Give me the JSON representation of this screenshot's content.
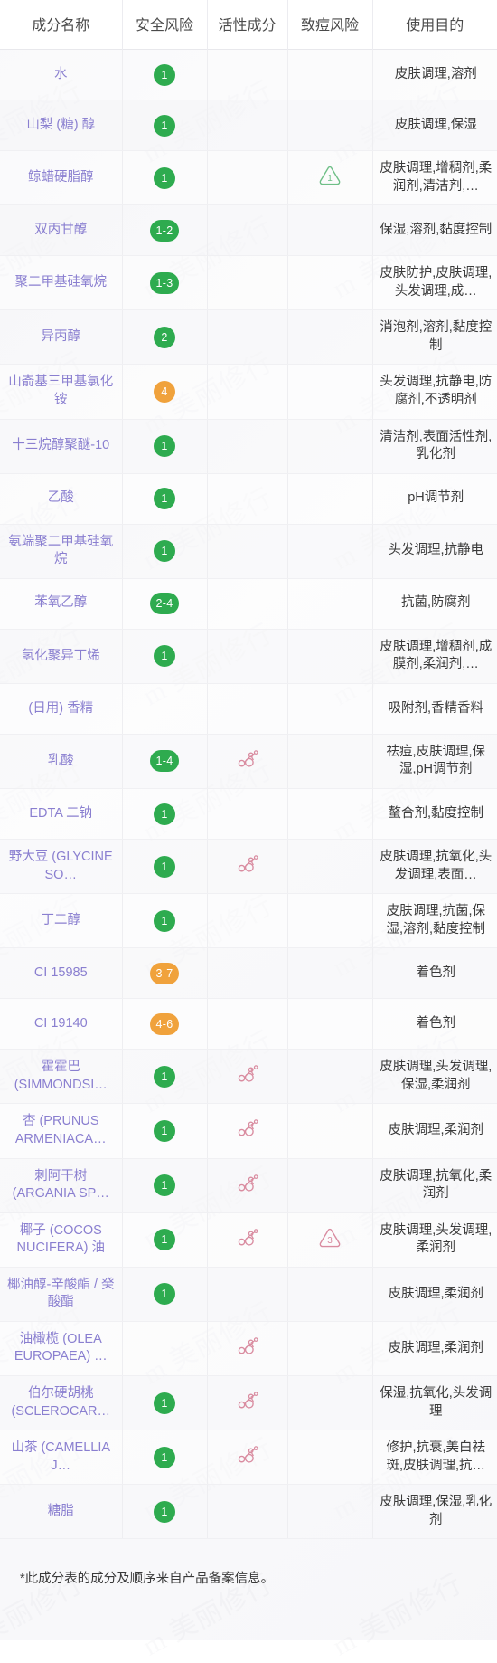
{
  "table": {
    "columns": [
      "成分名称",
      "安全风险",
      "活性成分",
      "致痘风险",
      "使用目的"
    ],
    "icons": {
      "active_ingredient": "molecule-icon",
      "acne_risk": "warning-triangle-icon"
    },
    "colors": {
      "badge_green": "#2eab4f",
      "badge_orange": "#f0a23c",
      "name_text": "#8a7fd0",
      "triangle_green": "#6fbf87",
      "triangle_pink": "#d98ca0",
      "molecule_pink": "#d98ca0"
    },
    "rows": [
      {
        "name": "水",
        "risk": "1",
        "risk_level": "green",
        "active": false,
        "acne": "",
        "acne_level": "",
        "use": "皮肤调理,溶剂"
      },
      {
        "name": "山梨 (糖) 醇",
        "risk": "1",
        "risk_level": "green",
        "active": false,
        "acne": "",
        "acne_level": "",
        "use": "皮肤调理,保湿"
      },
      {
        "name": "鲸蜡硬脂醇",
        "risk": "1",
        "risk_level": "green",
        "active": false,
        "acne": "1",
        "acne_level": "green",
        "use": "皮肤调理,增稠剂,柔润剂,清洁剂,…"
      },
      {
        "name": "双丙甘醇",
        "risk": "1-2",
        "risk_level": "green",
        "active": false,
        "acne": "",
        "acne_level": "",
        "use": "保湿,溶剂,黏度控制"
      },
      {
        "name": "聚二甲基硅氧烷",
        "risk": "1-3",
        "risk_level": "green",
        "active": false,
        "acne": "",
        "acne_level": "",
        "use": "皮肤防护,皮肤调理,头发调理,成…"
      },
      {
        "name": "异丙醇",
        "risk": "2",
        "risk_level": "green",
        "active": false,
        "acne": "",
        "acne_level": "",
        "use": "消泡剂,溶剂,黏度控制"
      },
      {
        "name": "山嵛基三甲基氯化铵",
        "risk": "4",
        "risk_level": "orange",
        "active": false,
        "acne": "",
        "acne_level": "",
        "use": "头发调理,抗静电,防腐剂,不透明剂"
      },
      {
        "name": "十三烷醇聚醚-10",
        "risk": "1",
        "risk_level": "green",
        "active": false,
        "acne": "",
        "acne_level": "",
        "use": "清洁剂,表面活性剂,乳化剂"
      },
      {
        "name": "乙酸",
        "risk": "1",
        "risk_level": "green",
        "active": false,
        "acne": "",
        "acne_level": "",
        "use": "pH调节剂"
      },
      {
        "name": "氨端聚二甲基硅氧烷",
        "risk": "1",
        "risk_level": "green",
        "active": false,
        "acne": "",
        "acne_level": "",
        "use": "头发调理,抗静电"
      },
      {
        "name": "苯氧乙醇",
        "risk": "2-4",
        "risk_level": "green",
        "active": false,
        "acne": "",
        "acne_level": "",
        "use": "抗菌,防腐剂"
      },
      {
        "name": "氢化聚异丁烯",
        "risk": "1",
        "risk_level": "green",
        "active": false,
        "acne": "",
        "acne_level": "",
        "use": "皮肤调理,增稠剂,成膜剂,柔润剂,…"
      },
      {
        "name": "(日用) 香精",
        "risk": "",
        "risk_level": "",
        "active": false,
        "acne": "",
        "acne_level": "",
        "use": "吸附剂,香精香料"
      },
      {
        "name": "乳酸",
        "risk": "1-4",
        "risk_level": "green",
        "active": true,
        "acne": "",
        "acne_level": "",
        "use": "祛痘,皮肤调理,保湿,pH调节剂"
      },
      {
        "name": "EDTA 二钠",
        "risk": "1",
        "risk_level": "green",
        "active": false,
        "acne": "",
        "acne_level": "",
        "use": "螯合剂,黏度控制"
      },
      {
        "name": "野大豆 (GLYCINE SO…",
        "risk": "1",
        "risk_level": "green",
        "active": true,
        "acne": "",
        "acne_level": "",
        "use": "皮肤调理,抗氧化,头发调理,表面…"
      },
      {
        "name": "丁二醇",
        "risk": "1",
        "risk_level": "green",
        "active": false,
        "acne": "",
        "acne_level": "",
        "use": "皮肤调理,抗菌,保湿,溶剂,黏度控制"
      },
      {
        "name": "CI 15985",
        "risk": "3-7",
        "risk_level": "orange",
        "active": false,
        "acne": "",
        "acne_level": "",
        "use": "着色剂"
      },
      {
        "name": "CI 19140",
        "risk": "4-6",
        "risk_level": "orange",
        "active": false,
        "acne": "",
        "acne_level": "",
        "use": "着色剂"
      },
      {
        "name": "霍霍巴 (SIMMONDSI…",
        "risk": "1",
        "risk_level": "green",
        "active": true,
        "acne": "",
        "acne_level": "",
        "use": "皮肤调理,头发调理,保湿,柔润剂"
      },
      {
        "name": "杏 (PRUNUS ARMENIACA…",
        "risk": "1",
        "risk_level": "green",
        "active": true,
        "acne": "",
        "acne_level": "",
        "use": "皮肤调理,柔润剂"
      },
      {
        "name": "刺阿干树 (ARGANIA SP…",
        "risk": "1",
        "risk_level": "green",
        "active": true,
        "acne": "",
        "acne_level": "",
        "use": "皮肤调理,抗氧化,柔润剂"
      },
      {
        "name": "椰子 (COCOS NUCIFERA) 油",
        "risk": "1",
        "risk_level": "green",
        "active": true,
        "acne": "3",
        "acne_level": "pink",
        "use": "皮肤调理,头发调理,柔润剂"
      },
      {
        "name": "椰油醇-辛酸酯 / 癸酸酯",
        "risk": "1",
        "risk_level": "green",
        "active": false,
        "acne": "",
        "acne_level": "",
        "use": "皮肤调理,柔润剂"
      },
      {
        "name": "油橄榄 (OLEA EUROPAEA) …",
        "risk": "",
        "risk_level": "",
        "active": true,
        "acne": "",
        "acne_level": "",
        "use": "皮肤调理,柔润剂"
      },
      {
        "name": "伯尔硬胡桃 (SCLEROCAR…",
        "risk": "1",
        "risk_level": "green",
        "active": true,
        "acne": "",
        "acne_level": "",
        "use": "保湿,抗氧化,头发调理"
      },
      {
        "name": "山茶 (CAMELLIA J…",
        "risk": "1",
        "risk_level": "green",
        "active": true,
        "acne": "",
        "acne_level": "",
        "use": "修护,抗衰,美白祛斑,皮肤调理,抗…"
      },
      {
        "name": "糖脂",
        "risk": "1",
        "risk_level": "green",
        "active": false,
        "acne": "",
        "acne_level": "",
        "use": "皮肤调理,保湿,乳化剂"
      }
    ]
  },
  "footnote": "*此成分表的成分及顺序来自产品备案信息。"
}
